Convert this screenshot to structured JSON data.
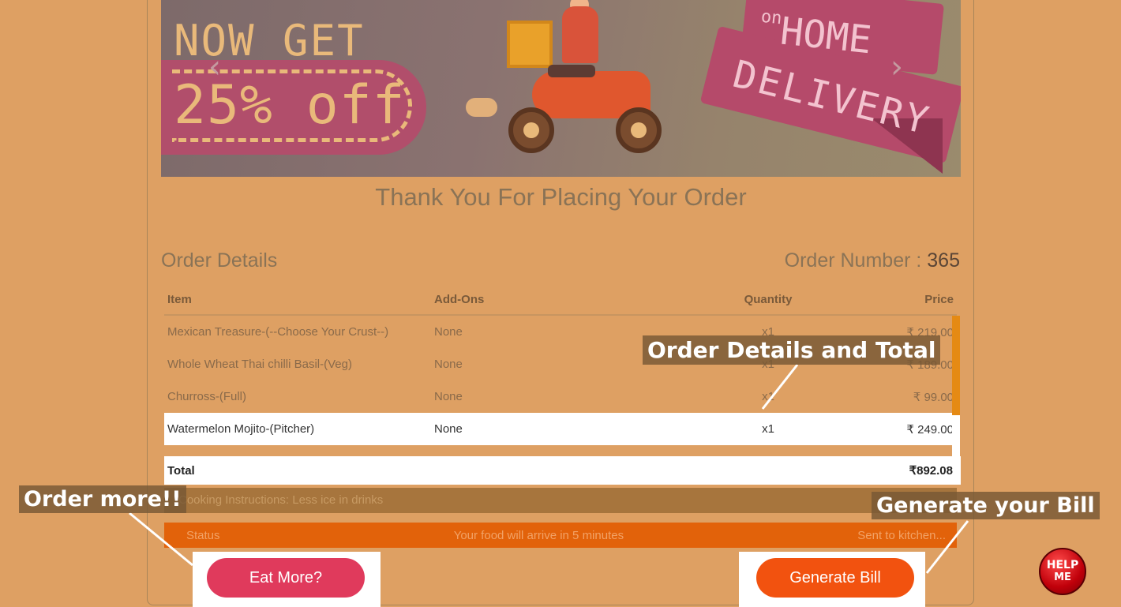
{
  "banner": {
    "left_line1": "NOW GET",
    "left_line2": "25% off",
    "right_on": "on",
    "right_home": "HOME",
    "right_delivery": "DELIVERY",
    "prev_arrow": "‹",
    "next_arrow": "›"
  },
  "thank_you": "Thank You For Placing Your Order",
  "order_details_title": "Order Details",
  "order_number_label": "Order Number :",
  "order_number": "365",
  "table": {
    "headers": [
      "Item",
      "Add-Ons",
      "Quantity",
      "Price"
    ],
    "rows": [
      {
        "item": "Mexican Treasure-(--Choose Your Crust--)",
        "addons": "None",
        "qty": "x1",
        "price": "₹ 219.00"
      },
      {
        "item": "Whole Wheat Thai chilli Basil-(Veg)",
        "addons": "None",
        "qty": "x1",
        "price": "₹ 189.00"
      },
      {
        "item": "Churross-(Full)",
        "addons": "None",
        "qty": "x1",
        "price": "₹ 99.00"
      },
      {
        "item": "Watermelon Mojito-(Pitcher)",
        "addons": "None",
        "qty": "x1",
        "price": "₹ 249.00"
      }
    ],
    "total_label": "Total",
    "total_value": "₹892.08"
  },
  "instructions": "Cooking Instructions: Less ice in drinks",
  "status": {
    "label": "Status",
    "message": "Your food will arrive in 5 minutes",
    "state": "Sent to kitchen..."
  },
  "buttons": {
    "eat_more": "Eat More?",
    "generate_bill": "Generate Bill"
  },
  "callouts": {
    "order_details": "Order Details and Total",
    "order_more": "Order more!!",
    "generate_bill": "Generate your Bill"
  },
  "help": {
    "line1": "HELP",
    "line2": "ME"
  },
  "colors": {
    "background": "#dea063",
    "eat_button": "#e03a5c",
    "bill_button": "#f2520f",
    "status_bar": "#e2620a",
    "scroll_thumb": "#e58a14"
  },
  "icons": [
    "chevron-left-icon",
    "chevron-right-icon",
    "delivery-scooter-illustration"
  ]
}
